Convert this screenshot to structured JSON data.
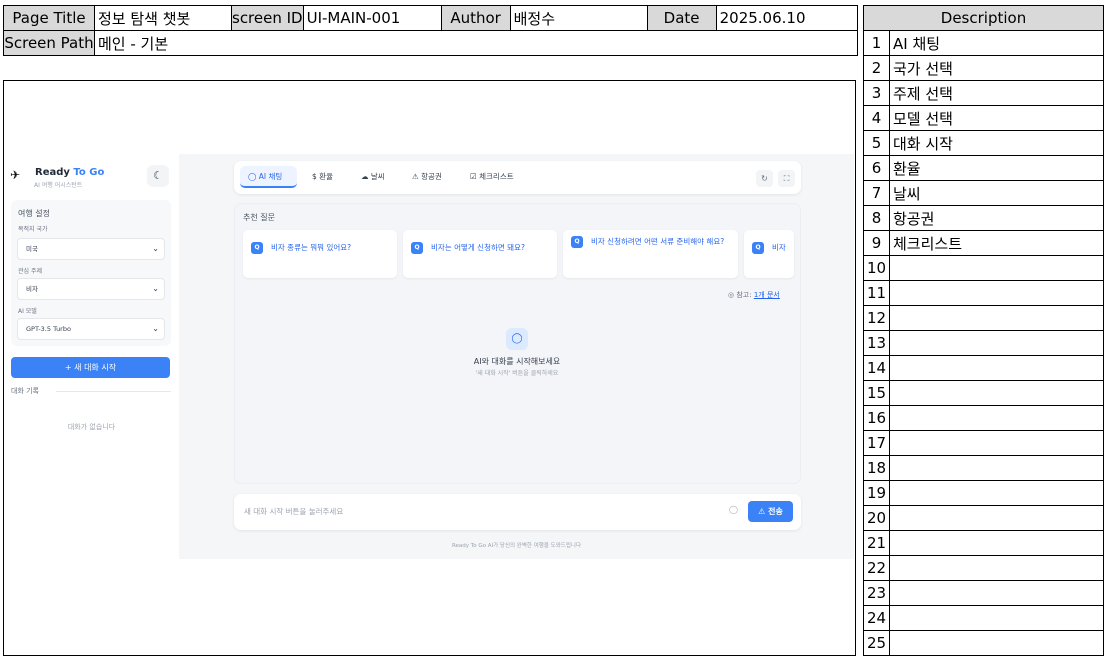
{
  "spec": {
    "page_title_label": "Page Title",
    "page_title": "정보 탐색 챗봇",
    "screen_id_label": "screen ID",
    "screen_id": "UI-MAIN-001",
    "author_label": "Author",
    "author": "배정수",
    "date_label": "Date",
    "date": "2025.06.10",
    "screen_path_label": "Screen Path",
    "screen_path": "메인 - 기본"
  },
  "description": {
    "header": "Description",
    "rows": [
      {
        "num": "1",
        "text": "AI 채팅"
      },
      {
        "num": "2",
        "text": "국가 선택"
      },
      {
        "num": "3",
        "text": "주제 선택"
      },
      {
        "num": "4",
        "text": "모델 선택"
      },
      {
        "num": "5",
        "text": "대화 시작"
      },
      {
        "num": "6",
        "text": "환율"
      },
      {
        "num": "7",
        "text": "날씨"
      },
      {
        "num": "8",
        "text": "항공권"
      },
      {
        "num": "9",
        "text": "체크리스트"
      },
      {
        "num": "10",
        "text": ""
      },
      {
        "num": "11",
        "text": ""
      },
      {
        "num": "12",
        "text": ""
      },
      {
        "num": "13",
        "text": ""
      },
      {
        "num": "14",
        "text": ""
      },
      {
        "num": "15",
        "text": ""
      },
      {
        "num": "16",
        "text": ""
      },
      {
        "num": "17",
        "text": ""
      },
      {
        "num": "18",
        "text": ""
      },
      {
        "num": "19",
        "text": ""
      },
      {
        "num": "20",
        "text": ""
      },
      {
        "num": "21",
        "text": ""
      },
      {
        "num": "22",
        "text": ""
      },
      {
        "num": "23",
        "text": ""
      },
      {
        "num": "24",
        "text": ""
      },
      {
        "num": "25",
        "text": ""
      }
    ]
  },
  "app": {
    "brand_main": "Ready",
    "brand_accent": "To Go",
    "brand_sub": "AI 여행 어시스턴트",
    "settings_title": "여행 설정",
    "country_label": "목적지 국가",
    "country_value": "미국",
    "topic_label": "관심 주제",
    "topic_value": "비자",
    "model_label": "AI 모델",
    "model_value": "GPT-3.5 Turbo",
    "new_chat": "+ 새 대화 시작",
    "history_label": "대화 기록",
    "history_empty": "대화가 없습니다",
    "tabs": [
      {
        "icon": "◯",
        "label": "AI 채팅"
      },
      {
        "icon": "$",
        "label": "환율"
      },
      {
        "icon": "☁",
        "label": "날씨"
      },
      {
        "icon": "⚠",
        "label": "항공권"
      },
      {
        "icon": "☑",
        "label": "체크리스트"
      }
    ],
    "rec_label": "추천 질문",
    "cards": [
      "비자 종류는 뭐뭐 있어요?",
      "비자는 어떻게 신청하면 돼요?",
      "비자 신청하려면 어떤 서류 준비해야 해요?",
      "비자"
    ],
    "ref_prefix": "참고:",
    "ref_link": "1개 문서",
    "empty_title": "AI와 대화를 시작해보세요",
    "empty_sub": "'새 대화 시작' 버튼을 클릭하세요",
    "input_placeholder": "새 대화 시작 버튼을 눌러주세요",
    "send_label": "전송",
    "footer": "Ready To Go AI가 당신의 완벽한 여행을 도와드립니다"
  }
}
